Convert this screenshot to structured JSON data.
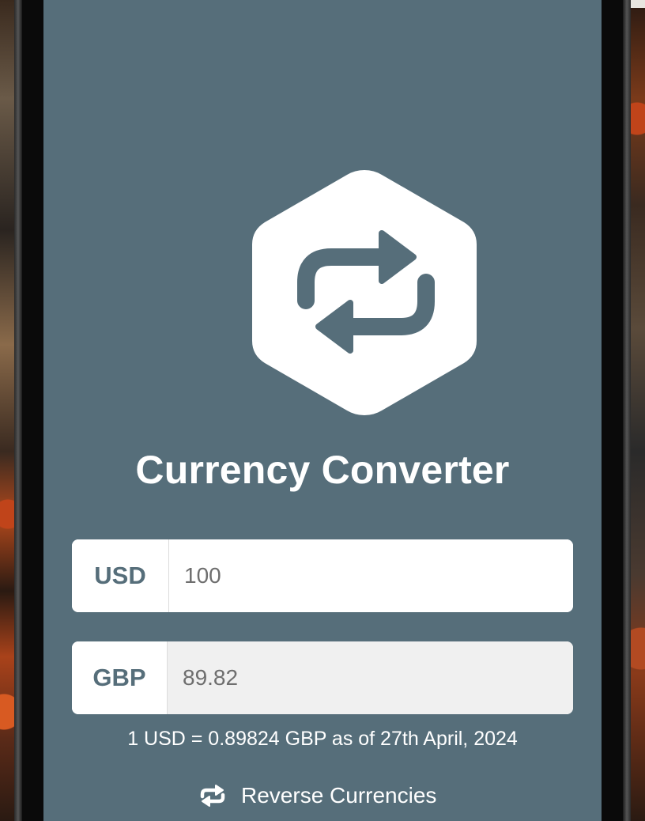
{
  "app": {
    "title": "Currency Converter",
    "icon": "exchange-arrows-hexagon-icon"
  },
  "from": {
    "code": "USD",
    "amount": "100"
  },
  "to": {
    "code": "GBP",
    "amount": "89.82"
  },
  "rate_text": "1 USD = 0.89824 GBP as of 27th April, 2024",
  "reverse": {
    "label": "Reverse Currencies",
    "icon": "swap-arrows-icon"
  },
  "colors": {
    "background": "#566e7a",
    "accent": "#566e7a",
    "text": "#ffffff"
  }
}
